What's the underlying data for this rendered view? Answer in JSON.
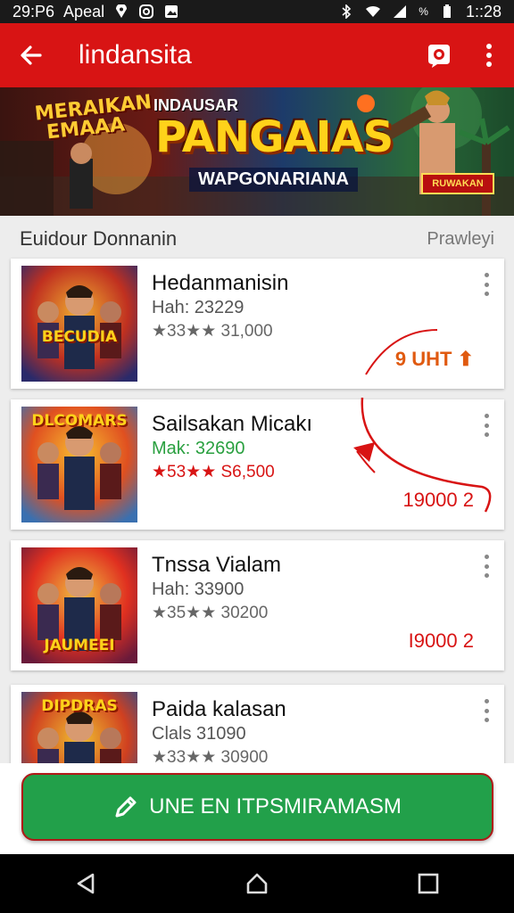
{
  "status_bar": {
    "time_left": "29:P6",
    "carrier": "Apeal",
    "battery_text": "%",
    "time_right": "1::28"
  },
  "app_bar": {
    "title": "lindansita"
  },
  "banner": {
    "small_title": "MERAIKAN EMAAA",
    "top_text": "INDAUSAR",
    "title": "PANGAIAS",
    "subtitle": "WAPGONARIANA",
    "tag": "RUWAKAN"
  },
  "section": {
    "title": "Euidour Donnanin",
    "link": "Prawleyi"
  },
  "items": [
    {
      "name": "Hedanmanisin",
      "meta": "Hah: 23229",
      "rating": "★33★★ 31,000",
      "price": "9 UHT ⬆",
      "thumb_text": "BECUDIA",
      "colors": [
        "#2a2a6a",
        "#c03020",
        "#f0b030"
      ]
    },
    {
      "name": "Sailsakan Micakı",
      "meta": "Mak: 32690",
      "rating": "★53★★ S6,500",
      "price": "19000 2",
      "thumb_text": "DLCOMARS",
      "colors": [
        "#3a70b0",
        "#e05020",
        "#f8c030"
      ]
    },
    {
      "name": "Tnssa Vialam",
      "meta": "Hah: 33900",
      "rating": "★35★★ 30200",
      "price": "I9000 2",
      "thumb_text": "JAUMEEI",
      "colors": [
        "#6a1a3a",
        "#e03020",
        "#f0c040"
      ]
    },
    {
      "name": "Paida kalasan",
      "meta": "Clals 31090",
      "rating": "★33★★ 30900",
      "price": "",
      "thumb_text": "DIPDRAS",
      "colors": [
        "#2a4a8a",
        "#d04020",
        "#f0c030"
      ]
    }
  ],
  "cta": {
    "label": "UNE EN ITPSMIRAMASM"
  },
  "icons": {
    "back": "arrow-left-icon",
    "camera": "camera-icon",
    "more": "more-vert-icon",
    "cta": "pencil-icon",
    "nav_back": "triangle-back-icon",
    "nav_home": "circle-home-icon",
    "nav_recent": "square-recent-icon"
  }
}
